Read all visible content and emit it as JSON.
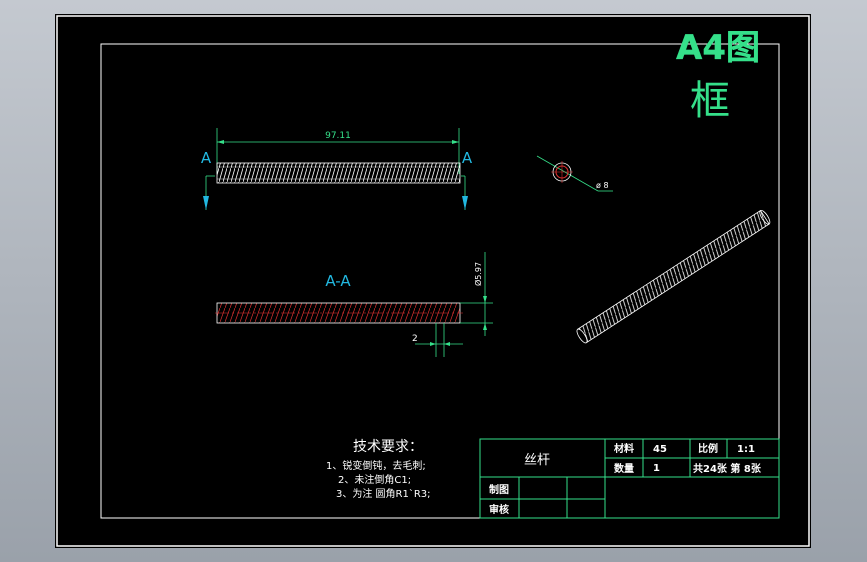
{
  "sheet": {
    "title_line1": "A4图",
    "title_line2": "框"
  },
  "front_view": {
    "length_dim": "97.11",
    "section_mark_left": "A",
    "section_mark_right": "A"
  },
  "end_view": {
    "diameter_dim": "ø 8"
  },
  "section_view": {
    "label": "A-A",
    "diameter_dim": "Ø5.97",
    "pitch_dim": "2"
  },
  "notes": {
    "heading": "技术要求：",
    "lines": [
      "1、锐变倒钝，去毛刺;",
      "2、未注倒角C1;",
      "3、为注 圆角R1`R3;"
    ]
  },
  "title_block": {
    "part_name": "丝杆",
    "material_label": "材料",
    "material_value": "45",
    "scale_label": "比例",
    "scale_value": "1:1",
    "qty_label": "数量",
    "qty_value": "1",
    "sheets_text": "共24张  第 8张",
    "drawn_label": "制图",
    "checked_label": "审核"
  },
  "colors": {
    "background": "#000000",
    "green": "#35e08a",
    "white": "#ffffff",
    "red": "#e03030",
    "cyan": "#22b8e0"
  }
}
